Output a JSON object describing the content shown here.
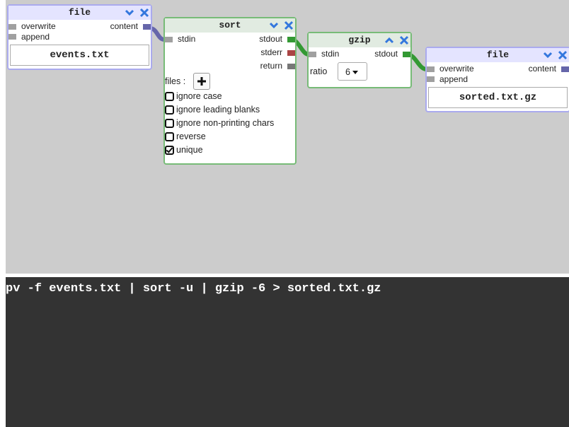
{
  "canvas": {
    "nodes": {
      "file_in": {
        "title": "file",
        "ports": {
          "overwrite": "overwrite",
          "append": "append",
          "content": "content"
        },
        "filename": "events.txt"
      },
      "sort": {
        "title": "sort",
        "ports": {
          "stdin": "stdin",
          "stdout": "stdout",
          "stderr": "stderr",
          "return": "return"
        },
        "files_label": "files :",
        "options": [
          {
            "label": "ignore case",
            "checked": false
          },
          {
            "label": "ignore leading blanks",
            "checked": false
          },
          {
            "label": "ignore non-printing chars",
            "checked": false
          },
          {
            "label": "reverse",
            "checked": false
          },
          {
            "label": "unique",
            "checked": true
          }
        ]
      },
      "gzip": {
        "title": "gzip",
        "ports": {
          "stdin": "stdin",
          "stdout": "stdout"
        },
        "ratio_label": "ratio",
        "ratio_value": "6"
      },
      "file_out": {
        "title": "file",
        "ports": {
          "overwrite": "overwrite",
          "append": "append",
          "content": "content"
        },
        "filename": "sorted.txt.gz"
      }
    },
    "colors": {
      "canvas_bg": "#cccccc",
      "file_border": "#aaaaee",
      "proc_border": "#77bb77",
      "pipe_green": "#339933",
      "pipe_blue": "#6666aa",
      "stderr_red": "#aa4444",
      "icon_blue": "#3377dd"
    }
  },
  "terminal": {
    "command": "pv -f events.txt | sort -u | gzip -6 > sorted.txt.gz"
  }
}
